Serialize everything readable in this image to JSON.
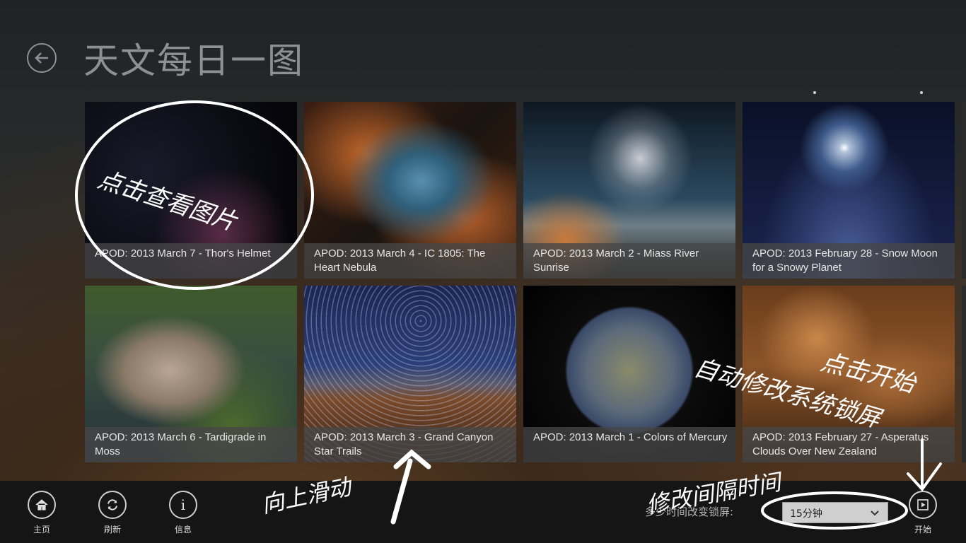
{
  "header": {
    "title": "天文每日一图"
  },
  "tiles": [
    {
      "caption": "APOD: 2013 March 7 - Thor's Helmet"
    },
    {
      "caption": "APOD: 2013 March 4 - IC 1805: The Heart Nebula"
    },
    {
      "caption": "APOD: 2013 March 2 - Miass River Sunrise"
    },
    {
      "caption": "APOD: 2013 February 28 - Snow Moon for a Snowy Planet"
    },
    {
      "caption": "APOD: 2013 March 6 - Tardigrade in Moss"
    },
    {
      "caption": "APOD: 2013 March 3 - Grand Canyon Star Trails"
    },
    {
      "caption": "APOD: 2013 March 1 - Colors of Mercury"
    },
    {
      "caption": "APOD: 2013 February 27 - Asperatus Clouds Over New Zealand"
    }
  ],
  "appbar": {
    "home_label": "主页",
    "refresh_label": "刷新",
    "info_label": "信息",
    "interval_label": "多少时间改变锁屏:",
    "interval_value": "15分钟",
    "start_label": "开始"
  },
  "annotations": {
    "click_view": "点击查看图片",
    "swipe_up": "向上滑动",
    "change_interval": "修改间隔时间",
    "auto_change": "自动修改系统锁屏",
    "click_start": "点击开始"
  }
}
